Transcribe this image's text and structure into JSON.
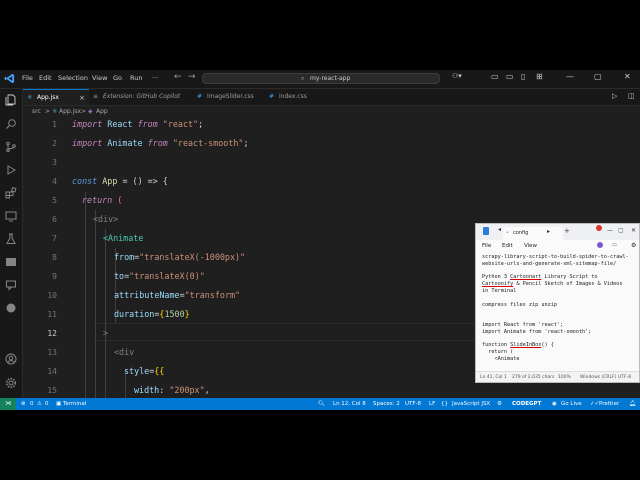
{
  "menu": [
    "File",
    "Edit",
    "Selection",
    "View",
    "Go",
    "Run"
  ],
  "command_center": {
    "text": "my-react-app"
  },
  "tabs": [
    {
      "label": "App.jsx",
      "icon": "react-icon"
    },
    {
      "label": "Extension: GitHub Copilot",
      "icon": "extension-icon"
    },
    {
      "label": "ImageSlider.css",
      "icon": "css-icon"
    },
    {
      "label": "index.css",
      "icon": "css-icon"
    }
  ],
  "breadcrumb": {
    "part1": "src",
    "sep": ">",
    "part2": "App.jsx",
    "part3": "App"
  },
  "code_lines": [
    {
      "num": "1"
    },
    {
      "num": "2"
    },
    {
      "num": "3"
    },
    {
      "num": "4"
    },
    {
      "num": "5"
    },
    {
      "num": "6"
    },
    {
      "num": "7"
    },
    {
      "num": "8"
    },
    {
      "num": "9"
    },
    {
      "num": "10"
    },
    {
      "num": "11"
    },
    {
      "num": "12"
    },
    {
      "num": "13"
    },
    {
      "num": "14"
    },
    {
      "num": "15"
    }
  ],
  "code": {
    "l1": {
      "kw": "import",
      "name": " React ",
      "from": "from",
      "str": " \"react\"",
      "end": ";"
    },
    "l2": {
      "kw": "import",
      "name": " Animate ",
      "from": "from",
      "str": " \"react-smooth\"",
      "end": ";"
    },
    "l4": {
      "kw": "const",
      "name": " App ",
      "rest": "= () => {"
    },
    "l5": {
      "kw": "return",
      "rest": " ("
    },
    "l6": {
      "tag": "<div>"
    },
    "l7": {
      "tag": "<Animate"
    },
    "l8": {
      "attr": "from",
      "eq": "=",
      "str": "\"translateX(-1000px)\""
    },
    "l9": {
      "attr": "to",
      "eq": "=",
      "str": "\"translateX(0)\""
    },
    "l10": {
      "attr": "attributeName",
      "eq": "=",
      "str": "\"transform\""
    },
    "l11": {
      "attr": "duration",
      "eq": "=",
      "open": "{",
      "num": "1500",
      "close": "}"
    },
    "l12": {
      "tag": ">"
    },
    "l13": {
      "tag": "<div"
    },
    "l14": {
      "attr": "style",
      "eq": "=",
      "open": "{{"
    },
    "l15": {
      "attr": "width",
      "colon": ": ",
      "str": "\"200px\"",
      "end": ","
    }
  },
  "status": {
    "errors": "0",
    "warnings": "0",
    "terminal": "Terminal",
    "position": "Ln 12, Col 8",
    "spaces": "Spaces: 2",
    "encoding": "UTF-8",
    "eol": "LF",
    "language": "JavaScript JSX",
    "extension": "CODEGPT",
    "golive": "Go Live",
    "prettier": "Prettier"
  },
  "notepad": {
    "tab_title": "config",
    "menu": [
      "File",
      "Edit",
      "View"
    ],
    "lines": [
      "scrapy-library-script-to-build-spider-to-crawl-",
      "website-urls-and-generate-xml-sitemap-file/",
      "",
      "Python 3 Cartoonart Library Script to",
      "Cartoonify & Pencil Sketch of Images & Videos",
      "in Terminal",
      "",
      "compress files zip unzip",
      "",
      "",
      "import React from 'react';",
      "import Animate from 'react-smooth';",
      "",
      "function SlideInBox() {",
      "  return (",
      "    <Animate"
    ],
    "status": {
      "pos": "Ln 41, Col 1",
      "chars": "279 of 2,035 chars",
      "zoom": "100%",
      "eol": "Windows (CRLF)",
      "enc": "UTF-8"
    }
  }
}
